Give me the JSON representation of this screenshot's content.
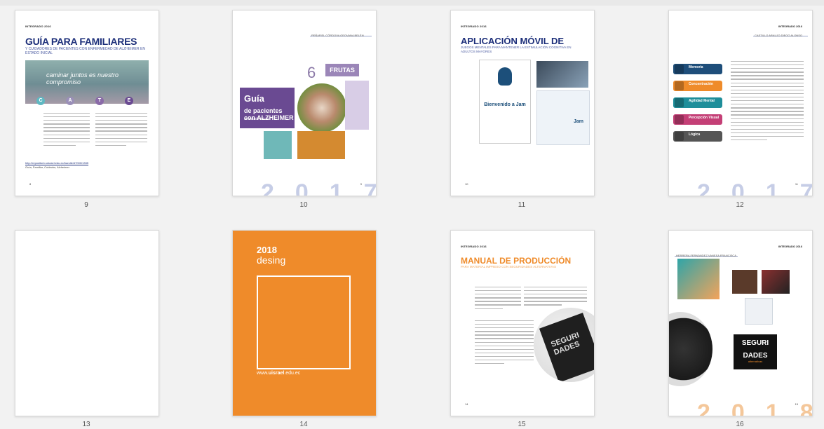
{
  "pages": [
    {
      "number": "9",
      "header": "INTEGRADO 2016",
      "title": "GUÍA PARA FAMILIARES",
      "subtitle": "Y CUIDADORES DE PACIENTES CON ENFERMEDAD DE ALZHEIMER EN ESTADO INICIAL",
      "banner_text": "caminar juntos es nuestro compromiso",
      "badges": [
        "C",
        "A",
        "T",
        "E"
      ],
      "footer_link": "http://repositorio.uisrael.edu.ec/handle/47000/1335",
      "footer_keywords": "Guía, Familiar, Cuidador, Alzheimer",
      "page_mark": "8"
    },
    {
      "number": "10",
      "header_run": "PEÑAFIEL CÓRDOVA GEOVANA BELÉN",
      "six": "6",
      "frutas_label": "FRUTAS",
      "book_title_1": "Guía",
      "book_title_2": "de pacientes con ALZHEIMER",
      "book_title_3": "en estado inicial",
      "year": "2017",
      "page_mark": "9"
    },
    {
      "number": "11",
      "header": "INTEGRADO 2016",
      "title": "APLICACIÓN MÓVIL DE",
      "subtitle": "JUEGOS MENTALES PARA MANTENER LA ESTIMULACIÓN COGNITIVA EN ADULTOS MAYORES",
      "welcome": "Bienvenido a Jam",
      "app_name": "Jam",
      "page_mark": "10"
    },
    {
      "number": "12",
      "header": "INTEGRADO 2016",
      "header_run": "CASTILLO ARAUJO DIEGO ALONSO",
      "skills": [
        "Memoria",
        "Concentración",
        "Agilidad Mental",
        "Percepción Visual",
        "Lógica"
      ],
      "year": "2017",
      "page_mark": "11"
    },
    {
      "number": "13"
    },
    {
      "number": "14",
      "year": "2018",
      "word": "desing",
      "url_prefix": "www.",
      "url_bold": "uisrael",
      "url_suffix": ".edu.ec"
    },
    {
      "number": "15",
      "header": "INTEGRADO 2016",
      "title": "MANUAL DE PRODUCCIÓN",
      "subtitle": "PARA MATERIAL IMPRESO CON SEGURIDADES ALTERNATIVAS",
      "book_text": "SEGURI DADES",
      "page_mark": "14"
    },
    {
      "number": "16",
      "header": "INTEGRADO 2016",
      "header_run": "HERRERA FERNÁNDEZ VANESA FRANCISCA",
      "poster_1": "SEGURI",
      "poster_2": "DADES",
      "poster_3": "alternativas",
      "year": "2018",
      "page_mark": "15"
    }
  ],
  "colors": {
    "navy": "#1d2f7a",
    "purple": "#6a4a92",
    "orange": "#ef8b2a",
    "teal": "#1e8e9a",
    "pink": "#c43f76"
  }
}
